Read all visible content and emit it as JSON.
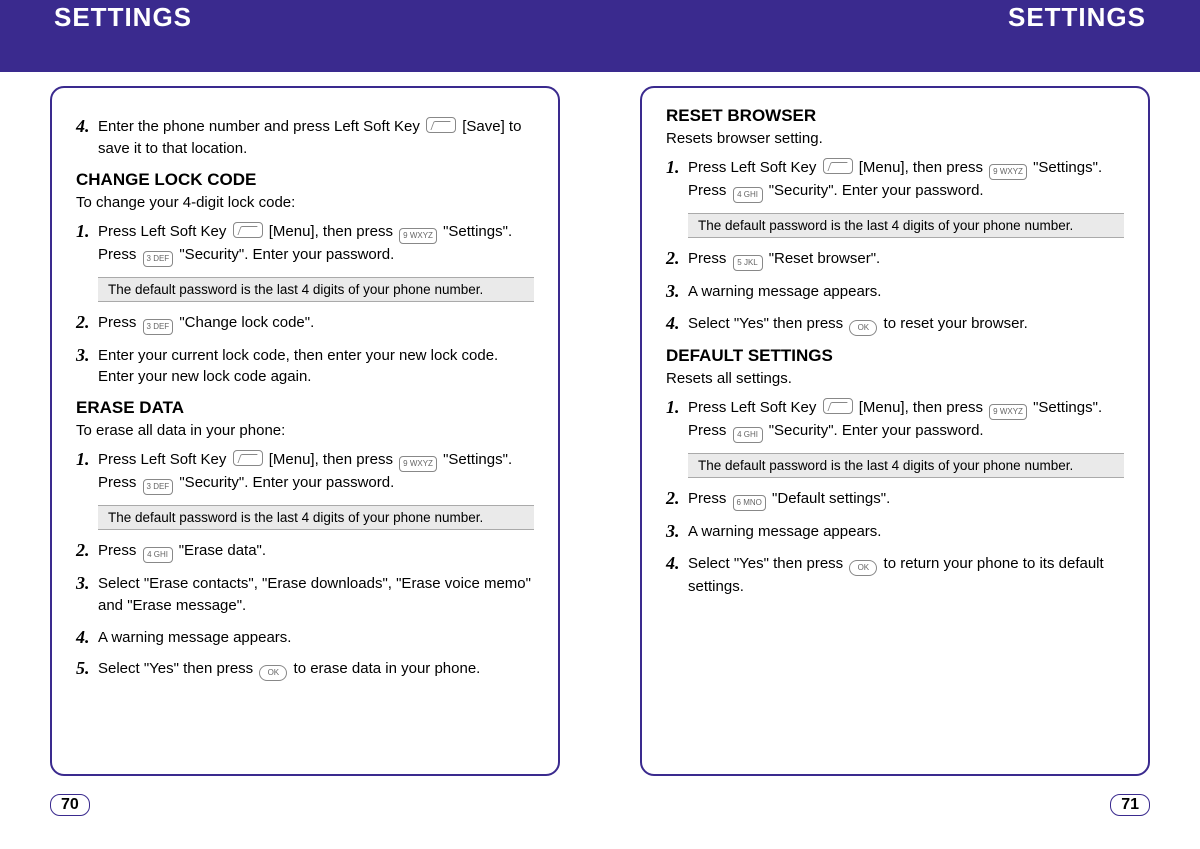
{
  "header": {
    "left": "SETTINGS",
    "right": "SETTINGS"
  },
  "pageNumbers": {
    "left": "70",
    "right": "71"
  },
  "keys": {
    "softkey": "",
    "k3": "3 DEF",
    "k4": "4 GHI",
    "k5": "5 JKL",
    "k6": "6 MNO",
    "k9": "9 WXYZ",
    "ok": "OK"
  },
  "notes": {
    "defaultPw": "The default password is the last 4 digits of your phone number."
  },
  "left": {
    "step4_intro_a": "Enter the phone number and press Left Soft Key ",
    "step4_intro_b": " [Save] to save it to that location.",
    "changeLock": {
      "title": "CHANGE LOCK CODE",
      "sub": "To change your 4-digit lock code:",
      "s1a": "Press Left Soft Key ",
      "s1b": " [Menu], then press ",
      "s1c": " \"Settings\". Press ",
      "s1d": " \"Security\". Enter your password.",
      "s2a": "Press ",
      "s2b": " \"Change lock code\".",
      "s3": "Enter your current lock code, then enter your new lock code. Enter your new lock code again."
    },
    "eraseData": {
      "title": "ERASE DATA",
      "sub": "To erase all data in your phone:",
      "s1a": "Press Left Soft Key ",
      "s1b": " [Menu], then press ",
      "s1c": " \"Settings\". Press ",
      "s1d": " \"Security\". Enter your password.",
      "s2a": "Press ",
      "s2b": " \"Erase data\".",
      "s3": "Select \"Erase contacts\", \"Erase downloads\", \"Erase voice memo\" and \"Erase message\".",
      "s4": "A warning message appears.",
      "s5a": "Select \"Yes\" then press ",
      "s5b": " to erase data in your phone."
    }
  },
  "right": {
    "resetBrowser": {
      "title": "RESET BROWSER",
      "sub": "Resets browser setting.",
      "s1a": "Press Left Soft Key ",
      "s1b": " [Menu], then press ",
      "s1c": " \"Settings\". Press ",
      "s1d": " \"Security\". Enter your password.",
      "s2a": "Press ",
      "s2b": " \"Reset browser\".",
      "s3": "A warning message appears.",
      "s4a": "Select \"Yes\" then press ",
      "s4b": " to reset your browser."
    },
    "defaultSettings": {
      "title": "DEFAULT SETTINGS",
      "sub": "Resets all settings.",
      "s1a": "Press Left Soft Key ",
      "s1b": " [Menu], then press ",
      "s1c": " \"Settings\". Press ",
      "s1d": " \"Security\". Enter your password.",
      "s2a": "Press ",
      "s2b": " \"Default settings\".",
      "s3": "A warning message appears.",
      "s4a": "Select \"Yes\" then press ",
      "s4b": " to return your phone to its default settings."
    }
  },
  "nums": {
    "n1": "1.",
    "n2": "2.",
    "n3": "3.",
    "n4": "4.",
    "n5": "5."
  }
}
